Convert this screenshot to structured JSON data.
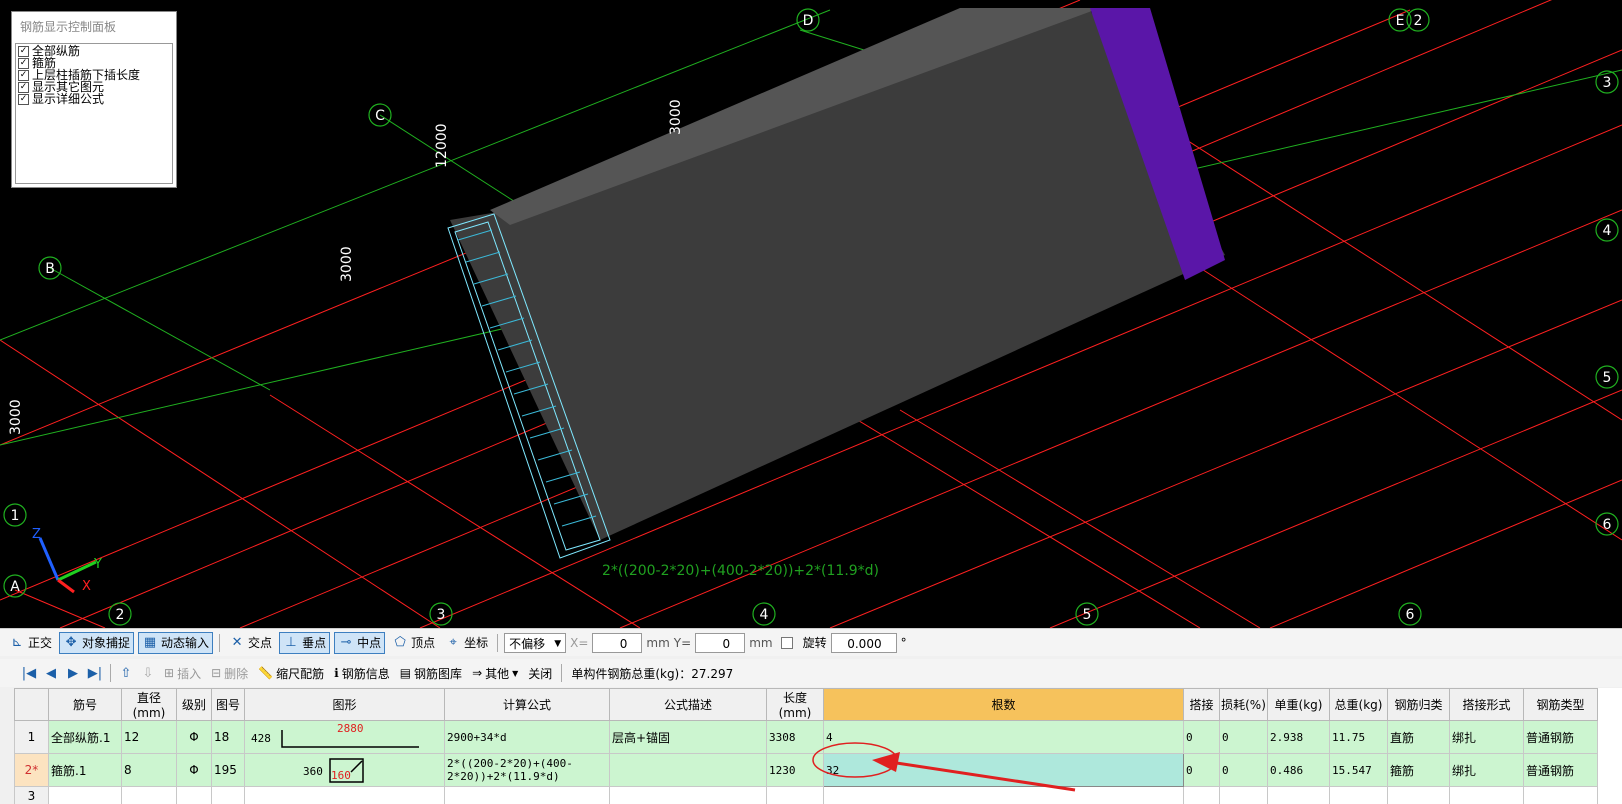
{
  "control_panel": {
    "title": "钢筋显示控制面板",
    "items": [
      {
        "label": "全部纵筋",
        "checked": true
      },
      {
        "label": "箍筋",
        "checked": true
      },
      {
        "label": "上层柱插筋下插长度",
        "checked": true
      },
      {
        "label": "显示其它图元",
        "checked": true
      },
      {
        "label": "显示详细公式",
        "checked": true
      }
    ]
  },
  "viewport": {
    "axis_labels": {
      "letters": [
        "A",
        "B",
        "C",
        "D",
        "E"
      ],
      "numbers_top": [
        "2",
        "3",
        "4",
        "5",
        "6"
      ],
      "numbers_bottom": [
        "1",
        "2",
        "3",
        "4",
        "5",
        "6"
      ]
    },
    "dimensions": {
      "d1": "3000",
      "d2": "12000",
      "d3": "3000",
      "d4": "3000"
    },
    "formula_overlay": "2*((200-2*20)+(400-2*20))+2*(11.9*d)",
    "axis_gizmo": {
      "z": "Z",
      "y": "Y",
      "x": "X"
    },
    "colors": {
      "axis_red": "#ff2020",
      "axis_green": "#20c020",
      "beam_gray": "#3c3c3c",
      "beam_purple": "#5a16a8",
      "rebar_cyan": "#7fe8ff"
    }
  },
  "snapbar": {
    "orthogonal": "正交",
    "object_snap": "对象捕捉",
    "dynamic_input": "动态输入",
    "intersection": "交点",
    "perpendicular": "垂点",
    "midpoint": "中点",
    "vertex": "顶点",
    "coordinate": "坐标",
    "offset_mode": "不偏移",
    "x_label": "X=",
    "x_value": "0",
    "unit1": "mm",
    "y_label": "Y=",
    "y_value": "0",
    "unit2": "mm",
    "rotate_label": "旋转",
    "rotate_value": "0.000",
    "degree": "°"
  },
  "rebarbar": {
    "insert": "插入",
    "delete": "删除",
    "scale_config": "缩尺配筋",
    "rebar_info": "钢筋信息",
    "rebar_library": "钢筋图库",
    "other": "其他",
    "close": "关闭",
    "total_weight": "单构件钢筋总重(kg)：27.297"
  },
  "table": {
    "headers": [
      "筋号",
      "直径(mm)",
      "级别",
      "图号",
      "图形",
      "计算公式",
      "公式描述",
      "长度(mm)",
      "根数",
      "搭接",
      "损耗(%)",
      "单重(kg)",
      "总重(kg)",
      "钢筋归类",
      "搭接形式",
      "钢筋类型"
    ],
    "rows": [
      {
        "idx": "1",
        "name": "全部纵筋.1",
        "dia": "12",
        "grade": "Φ",
        "fig": "18",
        "shape_left": "428",
        "shape_top": "2880",
        "formula": "2900+34*d",
        "desc": "层高+锚固",
        "len": "3308",
        "count": "4",
        "lap": "0",
        "loss": "0",
        "unit_w": "2.938",
        "total_w": "11.75",
        "category": "直筋",
        "lap_type": "绑扎",
        "rebar_type": "普通钢筋"
      },
      {
        "idx": "2*",
        "name": "箍筋.1",
        "dia": "8",
        "grade": "Φ",
        "fig": "195",
        "shape_left": "360",
        "shape_top": "160",
        "formula": "2*((200-2*20)+(400-2*20))+2*(11.9*d)",
        "desc": "",
        "len": "1230",
        "count": "32",
        "lap": "0",
        "loss": "0",
        "unit_w": "0.486",
        "total_w": "15.547",
        "category": "箍筋",
        "lap_type": "绑扎",
        "rebar_type": "普通钢筋"
      },
      {
        "idx": "3"
      }
    ]
  }
}
